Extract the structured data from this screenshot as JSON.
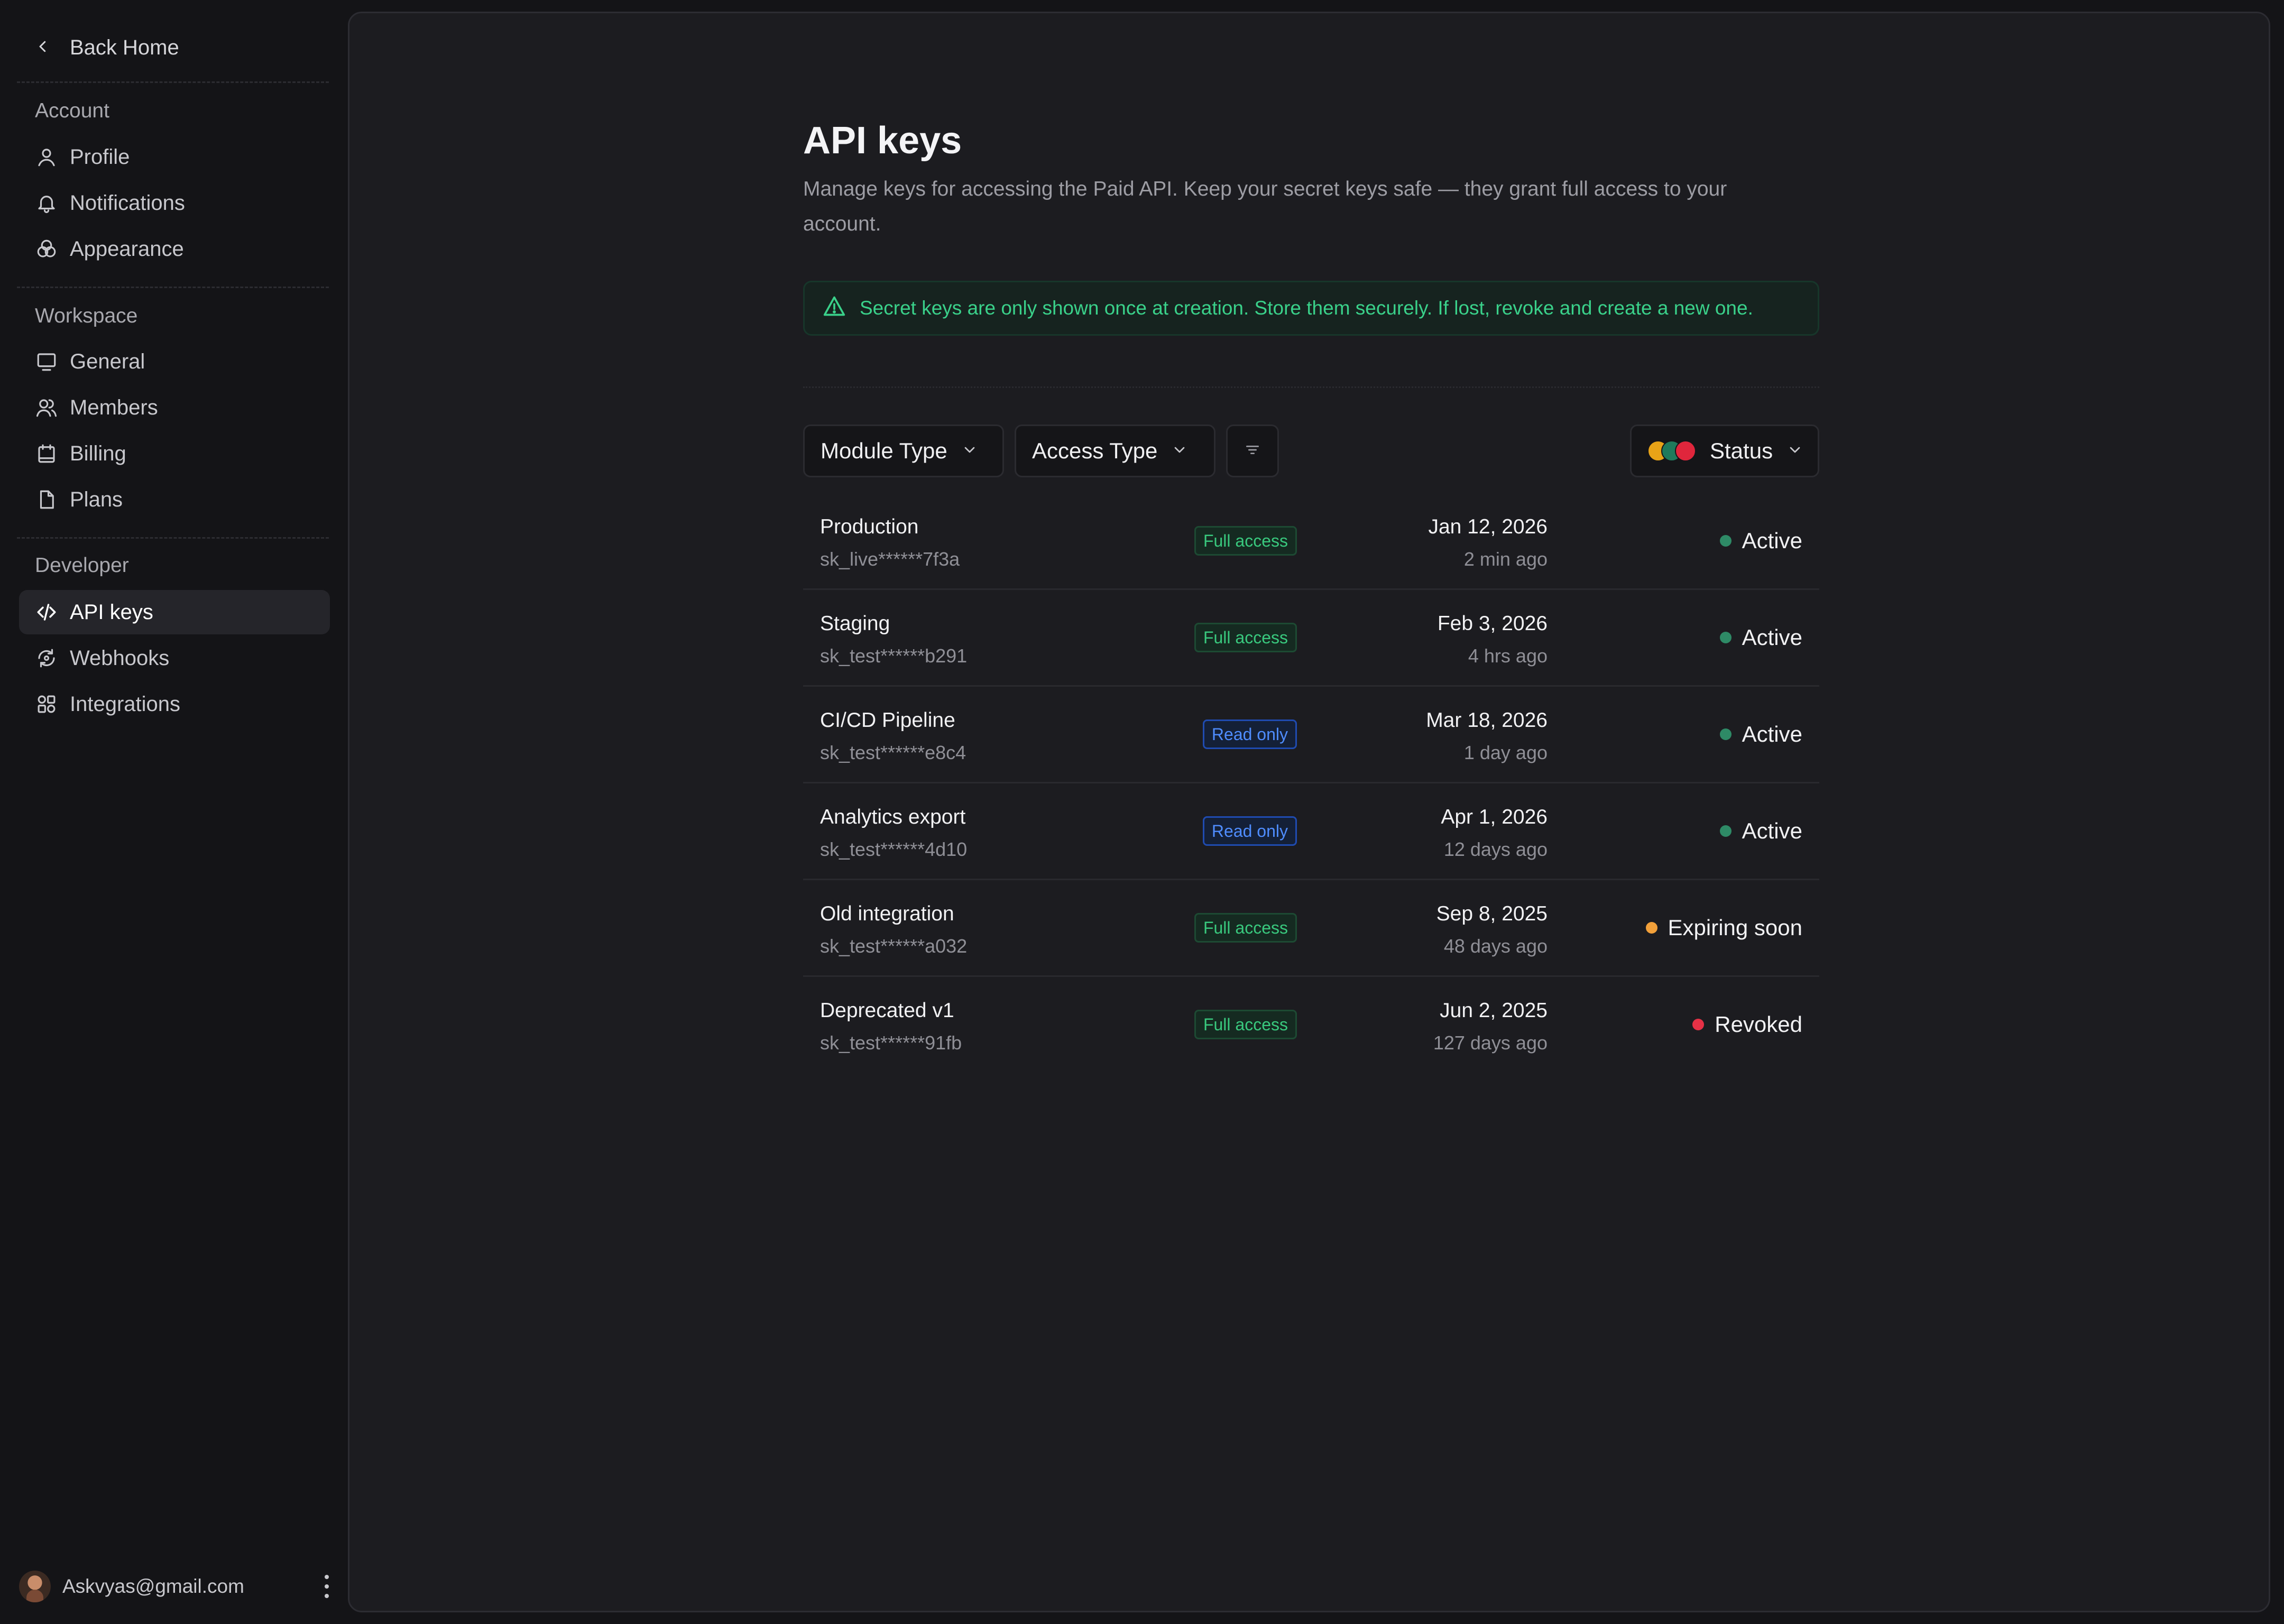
{
  "sidebar": {
    "back_label": "Back Home",
    "sections": [
      {
        "label": "Account",
        "items": [
          {
            "label": "Profile",
            "icon": "user-icon"
          },
          {
            "label": "Notifications",
            "icon": "bell-icon"
          },
          {
            "label": "Appearance",
            "icon": "palette-icon"
          }
        ]
      },
      {
        "label": "Workspace",
        "items": [
          {
            "label": "General",
            "icon": "monitor-icon"
          },
          {
            "label": "Members",
            "icon": "users-icon"
          },
          {
            "label": "Billing",
            "icon": "calendar-icon"
          },
          {
            "label": "Plans",
            "icon": "file-icon"
          }
        ]
      },
      {
        "label": "Developer",
        "items": [
          {
            "label": "API keys",
            "icon": "code-icon",
            "active": true
          },
          {
            "label": "Webhooks",
            "icon": "refresh-icon"
          },
          {
            "label": "Integrations",
            "icon": "integrations-icon"
          }
        ]
      }
    ],
    "user_email": "Askvyas@gmail.com"
  },
  "page": {
    "title": "API keys",
    "description": "Manage keys for accessing the Paid API. Keep your secret keys safe — they grant full access to your account.",
    "alert": "Secret keys are only shown once at creation. Store them securely. If lost, revoke and create a new one."
  },
  "filters": {
    "module_type": "Module Type",
    "access_type": "Access Type",
    "status": "Status",
    "status_colors": [
      "#e8a317",
      "#1f7a5c",
      "#e0263c"
    ]
  },
  "colors": {
    "active": "#2e8a66",
    "expiring": "#f2a03a",
    "revoked": "#e63146"
  },
  "keys": [
    {
      "name": "Production",
      "key": "sk_live******7f3a",
      "access": "Full access",
      "access_kind": "full",
      "date": "Jan 12, 2026",
      "ago": "2 min ago",
      "status": "Active",
      "status_kind": "active"
    },
    {
      "name": "Staging",
      "key": "sk_test******b291",
      "access": "Full access",
      "access_kind": "full",
      "date": "Feb 3, 2026",
      "ago": "4 hrs ago",
      "status": "Active",
      "status_kind": "active"
    },
    {
      "name": "CI/CD Pipeline",
      "key": "sk_test******e8c4",
      "access": "Read only",
      "access_kind": "read",
      "date": "Mar 18, 2026",
      "ago": "1 day ago",
      "status": "Active",
      "status_kind": "active"
    },
    {
      "name": "Analytics export",
      "key": "sk_test******4d10",
      "access": "Read only",
      "access_kind": "read",
      "date": "Apr 1, 2026",
      "ago": "12 days ago",
      "status": "Active",
      "status_kind": "active"
    },
    {
      "name": "Old integration",
      "key": "sk_test******a032",
      "access": "Full access",
      "access_kind": "full",
      "date": "Sep 8, 2025",
      "ago": "48 days ago",
      "status": "Expiring soon",
      "status_kind": "expiring"
    },
    {
      "name": "Deprecated v1",
      "key": "sk_test******91fb",
      "access": "Full access",
      "access_kind": "full",
      "date": "Jun 2, 2025",
      "ago": "127 days ago",
      "status": "Revoked",
      "status_kind": "revoked"
    }
  ]
}
